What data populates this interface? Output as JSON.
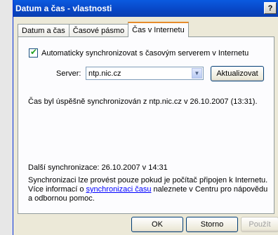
{
  "window": {
    "title": "Datum a čas - vlastnosti",
    "help_glyph": "?"
  },
  "tabs": [
    {
      "label": "Datum a čas",
      "active": false
    },
    {
      "label": "Časové pásmo",
      "active": false
    },
    {
      "label": "Čas v Internetu",
      "active": true
    }
  ],
  "internet_time": {
    "auto_sync_label": "Automaticky synchronizovat s časovým serverem v Internetu",
    "auto_sync_checked": true,
    "server_label": "Server:",
    "server_value": "ntp.nic.cz",
    "update_button": "Aktualizovat",
    "status": "Čas byl úspěšně synchronizován z ntp.nic.cz v 26.10.2007 (13:31).",
    "next_sync": "Další synchronizace: 26.10.2007 v 14:31",
    "info_before": "Synchronizaci lze provést pouze pokud je počítač připojen k Internetu. Více informací o ",
    "info_link": "synchronizaci času",
    "info_after": " naleznete v Centru pro nápovědu a odbornou pomoc."
  },
  "footer": {
    "ok": "OK",
    "cancel": "Storno",
    "apply": "Použít"
  }
}
